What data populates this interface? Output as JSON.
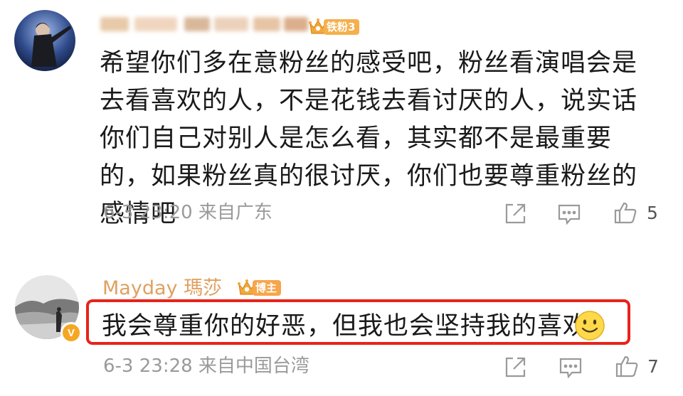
{
  "comments": [
    {
      "username_blurred": true,
      "badge": {
        "label": "铁粉3",
        "color": "#f5b04b"
      },
      "text": "希望你们多在意粉丝的感受吧，粉丝看演唱会是去看喜欢的人，不是花钱去看讨厌的人，说实话你们自己对别人是怎么看，其实都不是最重要的，如果粉丝真的很讨厌，你们也要尊重粉丝的感情吧",
      "meta": "6-3 23:20 来自广东",
      "actions": {
        "share_icon": "share-icon",
        "comment_icon": "comment-icon",
        "like_icon": "thumbs-up-icon",
        "like_count": "5"
      }
    },
    {
      "username": "Mayday 瑪莎",
      "badge": {
        "label": "博主",
        "color": "#f7a54a"
      },
      "verified": true,
      "text": "我会尊重你的好恶，但我也会坚持我的喜欢",
      "emoji_icon": "smile-emoji-icon",
      "highlight_color": "#e8231b",
      "meta": "6-3 23:28 来自中国台湾",
      "actions": {
        "share_icon": "share-icon",
        "comment_icon": "comment-icon",
        "like_icon": "thumbs-up-icon",
        "like_count": "7"
      }
    }
  ],
  "colors": {
    "username": "#e0a060",
    "body_text": "#1a1a1a",
    "meta_text": "#9a9a9a",
    "icon_stroke": "#9a9a9a"
  }
}
